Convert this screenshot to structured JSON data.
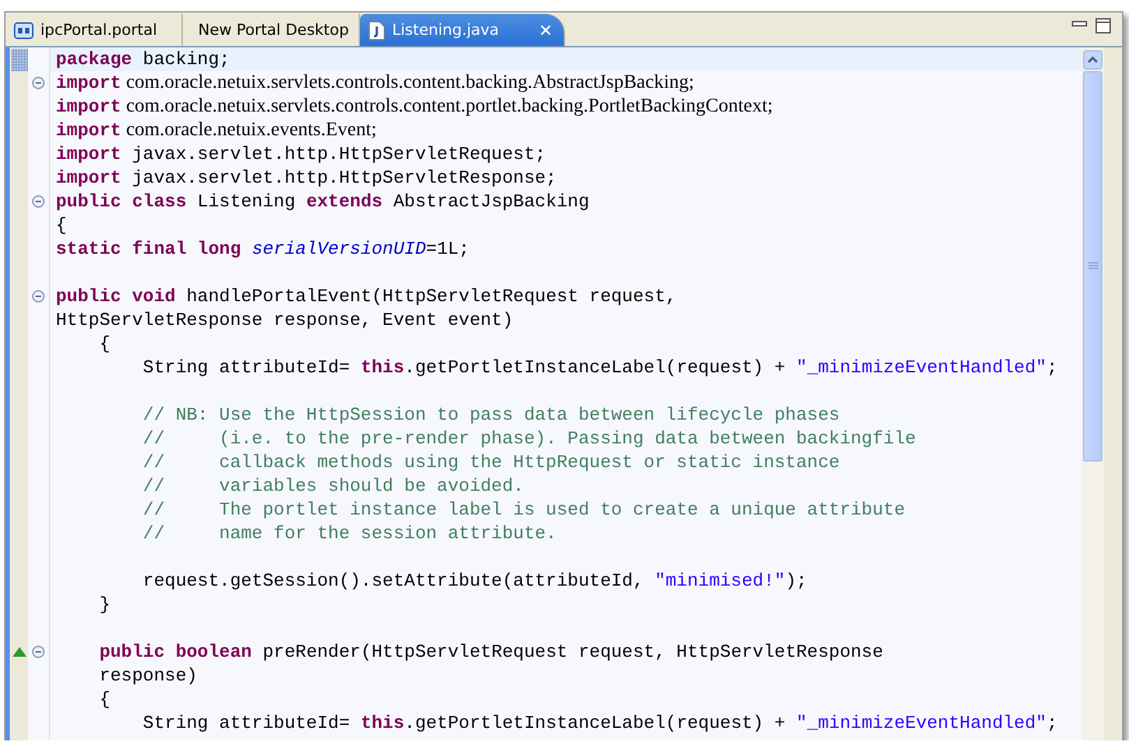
{
  "tabs": [
    {
      "label": "ipcPortal.portal",
      "selected": false
    },
    {
      "label": "New Portal Desktop",
      "selected": false
    },
    {
      "label": "Listening.java",
      "selected": true,
      "close": "✕"
    }
  ],
  "lines": [
    {
      "kind": "code",
      "current": true,
      "fold": false,
      "tokens": [
        {
          "kind": "kw",
          "text": "package"
        },
        {
          "kind": "plain",
          "text": " backing;"
        }
      ]
    },
    {
      "kind": "code",
      "current": false,
      "fold": true,
      "tokens": [
        {
          "kind": "kw",
          "text": "import"
        },
        {
          "kind": "serif",
          "text": " com.oracle.netuix.servlets.controls.content.backing.AbstractJspBacking;"
        }
      ]
    },
    {
      "kind": "code",
      "current": false,
      "fold": false,
      "tokens": [
        {
          "kind": "kw",
          "text": "import"
        },
        {
          "kind": "serif",
          "text": " com.oracle.netuix.servlets.controls.content.portlet.backing.PortletBackingContext;"
        }
      ]
    },
    {
      "kind": "code",
      "current": false,
      "fold": false,
      "tokens": [
        {
          "kind": "kw",
          "text": "import"
        },
        {
          "kind": "serif",
          "text": " com.oracle.netuix.events.Event;"
        }
      ]
    },
    {
      "kind": "code",
      "current": false,
      "fold": false,
      "tokens": [
        {
          "kind": "kw",
          "text": "import"
        },
        {
          "kind": "plain",
          "text": " javax.servlet.http.HttpServletRequest;"
        }
      ]
    },
    {
      "kind": "code",
      "current": false,
      "fold": false,
      "tokens": [
        {
          "kind": "kw",
          "text": "import"
        },
        {
          "kind": "plain",
          "text": " javax.servlet.http.HttpServletResponse;"
        }
      ]
    },
    {
      "kind": "code",
      "current": false,
      "fold": true,
      "tokens": [
        {
          "kind": "kw",
          "text": "public class"
        },
        {
          "kind": "plain",
          "text": " Listening "
        },
        {
          "kind": "kw",
          "text": "extends"
        },
        {
          "kind": "plain",
          "text": " AbstractJspBacking"
        }
      ]
    },
    {
      "kind": "code",
      "current": false,
      "fold": false,
      "tokens": [
        {
          "kind": "plain",
          "text": "{"
        }
      ]
    },
    {
      "kind": "code",
      "current": false,
      "fold": false,
      "tokens": [
        {
          "kind": "kw",
          "text": "static final long "
        },
        {
          "kind": "field",
          "text": "serialVersionUID"
        },
        {
          "kind": "plain",
          "text": "=1L;"
        }
      ]
    },
    {
      "kind": "code",
      "current": false,
      "fold": false
    },
    {
      "kind": "code",
      "current": false,
      "fold": true,
      "tokens": [
        {
          "kind": "kw",
          "text": "public void"
        },
        {
          "kind": "plain",
          "text": " handlePortalEvent(HttpServletRequest request,"
        }
      ]
    },
    {
      "kind": "code",
      "current": false,
      "fold": false,
      "tokens": [
        {
          "kind": "plain",
          "text": "HttpServletResponse response, Event event)"
        }
      ]
    },
    {
      "kind": "code",
      "current": false,
      "fold": false,
      "tokens": [
        {
          "kind": "plain",
          "text": "    {"
        }
      ]
    },
    {
      "kind": "code",
      "current": false,
      "fold": false,
      "tokens": [
        {
          "kind": "plain",
          "text": "        String attributeId= "
        },
        {
          "kind": "kw",
          "text": "this"
        },
        {
          "kind": "plain",
          "text": ".getPortletInstanceLabel(request) + "
        },
        {
          "kind": "str",
          "text": "\"_minimizeEventHandled\""
        },
        {
          "kind": "plain",
          "text": ";"
        }
      ]
    },
    {
      "kind": "code",
      "current": false,
      "fold": false
    },
    {
      "kind": "code",
      "current": false,
      "fold": false,
      "tokens": [
        {
          "kind": "comment",
          "text": "        // NB: Use the HttpSession to pass data between lifecycle phases"
        }
      ]
    },
    {
      "kind": "code",
      "current": false,
      "fold": false,
      "tokens": [
        {
          "kind": "comment",
          "text": "        //     (i.e. to the pre-render phase). Passing data between backingfile"
        }
      ]
    },
    {
      "kind": "code",
      "current": false,
      "fold": false,
      "tokens": [
        {
          "kind": "comment",
          "text": "        //     callback methods using the HttpRequest or static instance"
        }
      ]
    },
    {
      "kind": "code",
      "current": false,
      "fold": false,
      "tokens": [
        {
          "kind": "comment",
          "text": "        //     variables should be avoided."
        }
      ]
    },
    {
      "kind": "code",
      "current": false,
      "fold": false,
      "tokens": [
        {
          "kind": "comment",
          "text": "        //     The portlet instance label is used to create a unique attribute"
        }
      ]
    },
    {
      "kind": "code",
      "current": false,
      "fold": false,
      "tokens": [
        {
          "kind": "comment",
          "text": "        //     name for the session attribute."
        }
      ]
    },
    {
      "kind": "code",
      "current": false,
      "fold": false
    },
    {
      "kind": "code",
      "current": false,
      "fold": false,
      "tokens": [
        {
          "kind": "plain",
          "text": "        request.getSession().setAttribute(attributeId, "
        },
        {
          "kind": "str",
          "text": "\"minimised!\""
        },
        {
          "kind": "plain",
          "text": ");"
        }
      ]
    },
    {
      "kind": "code",
      "current": false,
      "fold": false,
      "tokens": [
        {
          "kind": "plain",
          "text": "    }"
        }
      ]
    },
    {
      "kind": "code",
      "current": false,
      "fold": false
    },
    {
      "kind": "override",
      "current": false,
      "fold": true,
      "tokens": [
        {
          "kind": "kw",
          "text": "    public boolean"
        },
        {
          "kind": "plain",
          "text": " preRender(HttpServletRequest request, HttpServletResponse"
        }
      ]
    },
    {
      "kind": "code",
      "current": false,
      "fold": false,
      "tokens": [
        {
          "kind": "plain",
          "text": "    response)"
        }
      ]
    },
    {
      "kind": "code",
      "current": false,
      "fold": false,
      "tokens": [
        {
          "kind": "plain",
          "text": "    {"
        }
      ]
    },
    {
      "kind": "code",
      "current": false,
      "fold": false,
      "tokens": [
        {
          "kind": "plain",
          "text": "        String attributeId= "
        },
        {
          "kind": "kw",
          "text": "this"
        },
        {
          "kind": "plain",
          "text": ".getPortletInstanceLabel(request) + "
        },
        {
          "kind": "str",
          "text": "\"_minimizeEventHandled\""
        },
        {
          "kind": "plain",
          "text": ";"
        }
      ]
    }
  ]
}
